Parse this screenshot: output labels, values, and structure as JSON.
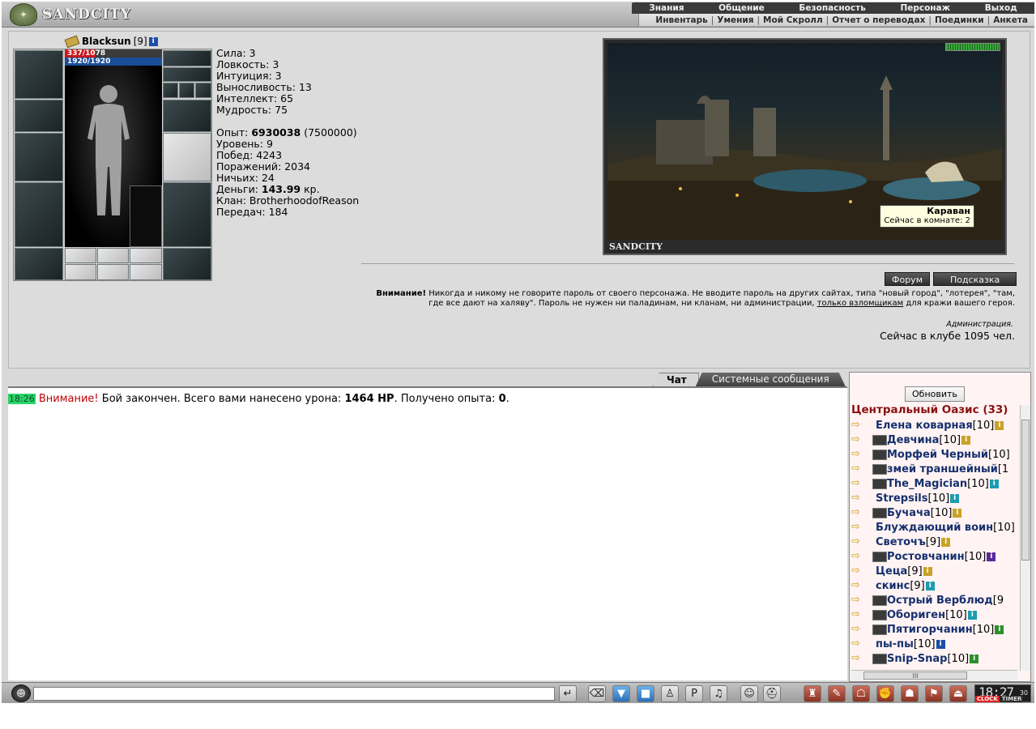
{
  "header": {
    "logo_text": "SANDCITY",
    "main_menu": [
      "Знания",
      "Общение",
      "Безопасность",
      "Персонаж",
      "Выход"
    ],
    "sub_menu": [
      "Инвентарь",
      "Умения",
      "Мой Скролл",
      "Отчет о переводах",
      "Поединки",
      "Анкета"
    ]
  },
  "character": {
    "name": "Blacksun",
    "level": "[9]",
    "hp_text": "337/1078",
    "hp_fraction": 0.3126,
    "mp_text": "1920/1920",
    "stats": [
      "Сила: 3",
      "Ловкость: 3",
      "Интуиция: 3",
      "Выносливость: 13",
      "Интеллект: 65",
      "Мудрость: 75"
    ],
    "exp_label": "Опыт: ",
    "exp_value": "6930038",
    "exp_next": " (7500000)",
    "level_line": "Уровень: 9",
    "wins_line": "Побед: 4243",
    "losses_line": "Поражений: 2034",
    "draws_line": "Ничьих: 24",
    "money_label": "Деньги: ",
    "money_value": "143.99",
    "money_unit": " кр.",
    "clan_line": "Клан: BrotherhoodofReason",
    "transfers_line": "Передач: 184"
  },
  "location": {
    "title": "SANDCITY",
    "tooltip_title": "Караван",
    "tooltip_text": "Сейчас в комнате: 2"
  },
  "buttons": {
    "forum": "Форум",
    "hint": "Подсказка",
    "refresh": "Обновить"
  },
  "warning": {
    "bold": "Внимание!",
    "text1": " Никогда и никому не говорите пароль от своего персонажа. Не вводите пароль на других сайтах, типа \"новый город\", \"лотерея\", \"там, где все дают на халяву\". Пароль не нужен ни паладинам, ни кланам, ни администрации, ",
    "link": "только взломщикам",
    "text2": " для кражи вашего героя.",
    "admin": "Администрация.",
    "online": "Сейчас в клубе 1095 чел."
  },
  "chat": {
    "tabs": [
      "Чат",
      "Системные сообщения"
    ],
    "time": "18:26",
    "alert": "Внимание!",
    "msg1": " Бой закончен. Всего вами нанесено урона: ",
    "damage": "1464 HP",
    "msg2": ". Получено опыта: ",
    "exp": "0",
    "msg3": "."
  },
  "room": {
    "title": "Центральный Оазис (33)",
    "users": [
      {
        "name": "Елена коварная",
        "level": "[10]",
        "info": "y",
        "clan": false
      },
      {
        "name": "Девчина",
        "level": "[10]",
        "info": "y",
        "clan": true
      },
      {
        "name": "Морфей Черный",
        "level": "[10]",
        "info": "",
        "clan": true
      },
      {
        "name": "змей траншейный",
        "level": "[1",
        "info": "",
        "clan": true
      },
      {
        "name": "The_Magician",
        "level": "[10]",
        "info": "c",
        "clan": true
      },
      {
        "name": "Strepsils",
        "level": "[10]",
        "info": "c",
        "clan": false
      },
      {
        "name": "Бучача",
        "level": "[10]",
        "info": "y",
        "clan": true
      },
      {
        "name": "Блуждающий воин",
        "level": "[10]",
        "info": "",
        "clan": false
      },
      {
        "name": "Светочъ",
        "level": "[9]",
        "info": "y",
        "clan": false
      },
      {
        "name": "Ростовчанин",
        "level": "[10]",
        "info": "p",
        "clan": true
      },
      {
        "name": "Цеца",
        "level": "[9]",
        "info": "y",
        "clan": false
      },
      {
        "name": "скинс",
        "level": "[9]",
        "info": "c",
        "clan": false
      },
      {
        "name": "Острый Верблюд",
        "level": "[9",
        "info": "",
        "clan": true
      },
      {
        "name": "Оборигeн",
        "level": "[10]",
        "info": "c",
        "clan": true
      },
      {
        "name": "Пятигорчанин",
        "level": "[10]",
        "info": "g",
        "clan": true
      },
      {
        "name": "пы-пы",
        "level": "[10]",
        "info": "b",
        "clan": false
      },
      {
        "name": "Snip-Snap",
        "level": "[10]",
        "info": "g",
        "clan": true
      }
    ]
  },
  "clock": {
    "time": "18:27",
    "seconds": "30",
    "label1": "CLOCK",
    "label2": "TIMER"
  },
  "icons": {
    "info": "i",
    "user_arrow": "⇨"
  }
}
